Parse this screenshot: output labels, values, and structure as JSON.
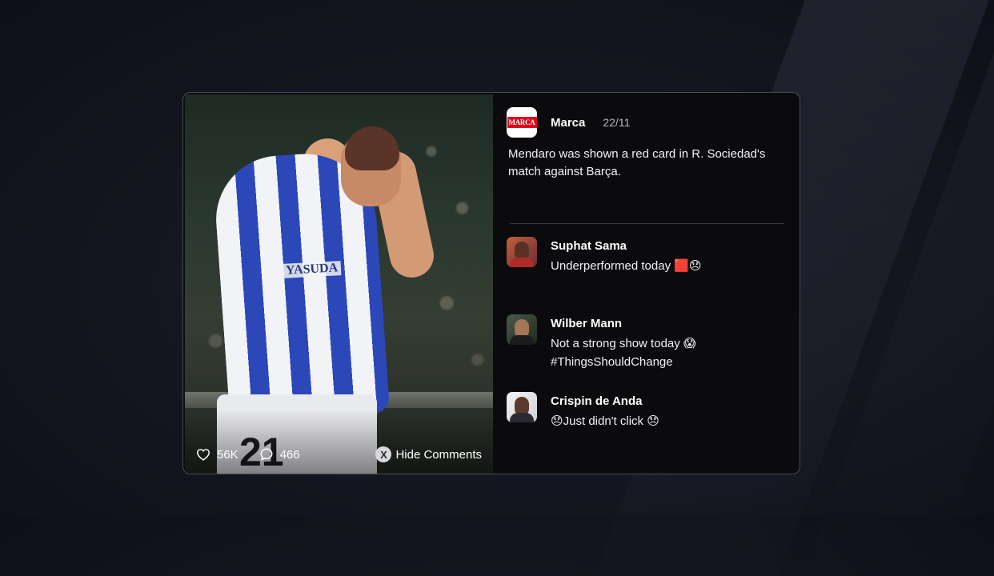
{
  "post": {
    "source_name": "Marca",
    "source_logo_text": "MARCA",
    "date": "22/11",
    "text": "Mendaro was shown a red card in R. Sociedad's match against Barça."
  },
  "photo": {
    "sponsor": "YASUDA",
    "shorts_number": "21"
  },
  "stats": {
    "likes": "56K",
    "comments": "466"
  },
  "actions": {
    "hide_button_key": "X",
    "hide_comments_label": "Hide Comments"
  },
  "comments": [
    {
      "name": "Suphat Sama",
      "text": "Underperformed today 🟥😞",
      "avatar_bg": "#8a3a2a"
    },
    {
      "name": "Wilber Mann",
      "text": "Not a strong show today 😱",
      "text2": "#ThingsShouldChange",
      "avatar_bg": "#3d4a3a"
    },
    {
      "name": "Crispin de Anda",
      "text": "😞Just didn't click 😞",
      "avatar_bg": "#e8e8ea"
    }
  ],
  "colors": {
    "card_bg": "#0b0b0e",
    "card_border": "#4a4d58",
    "marca_red": "#e0001b"
  }
}
